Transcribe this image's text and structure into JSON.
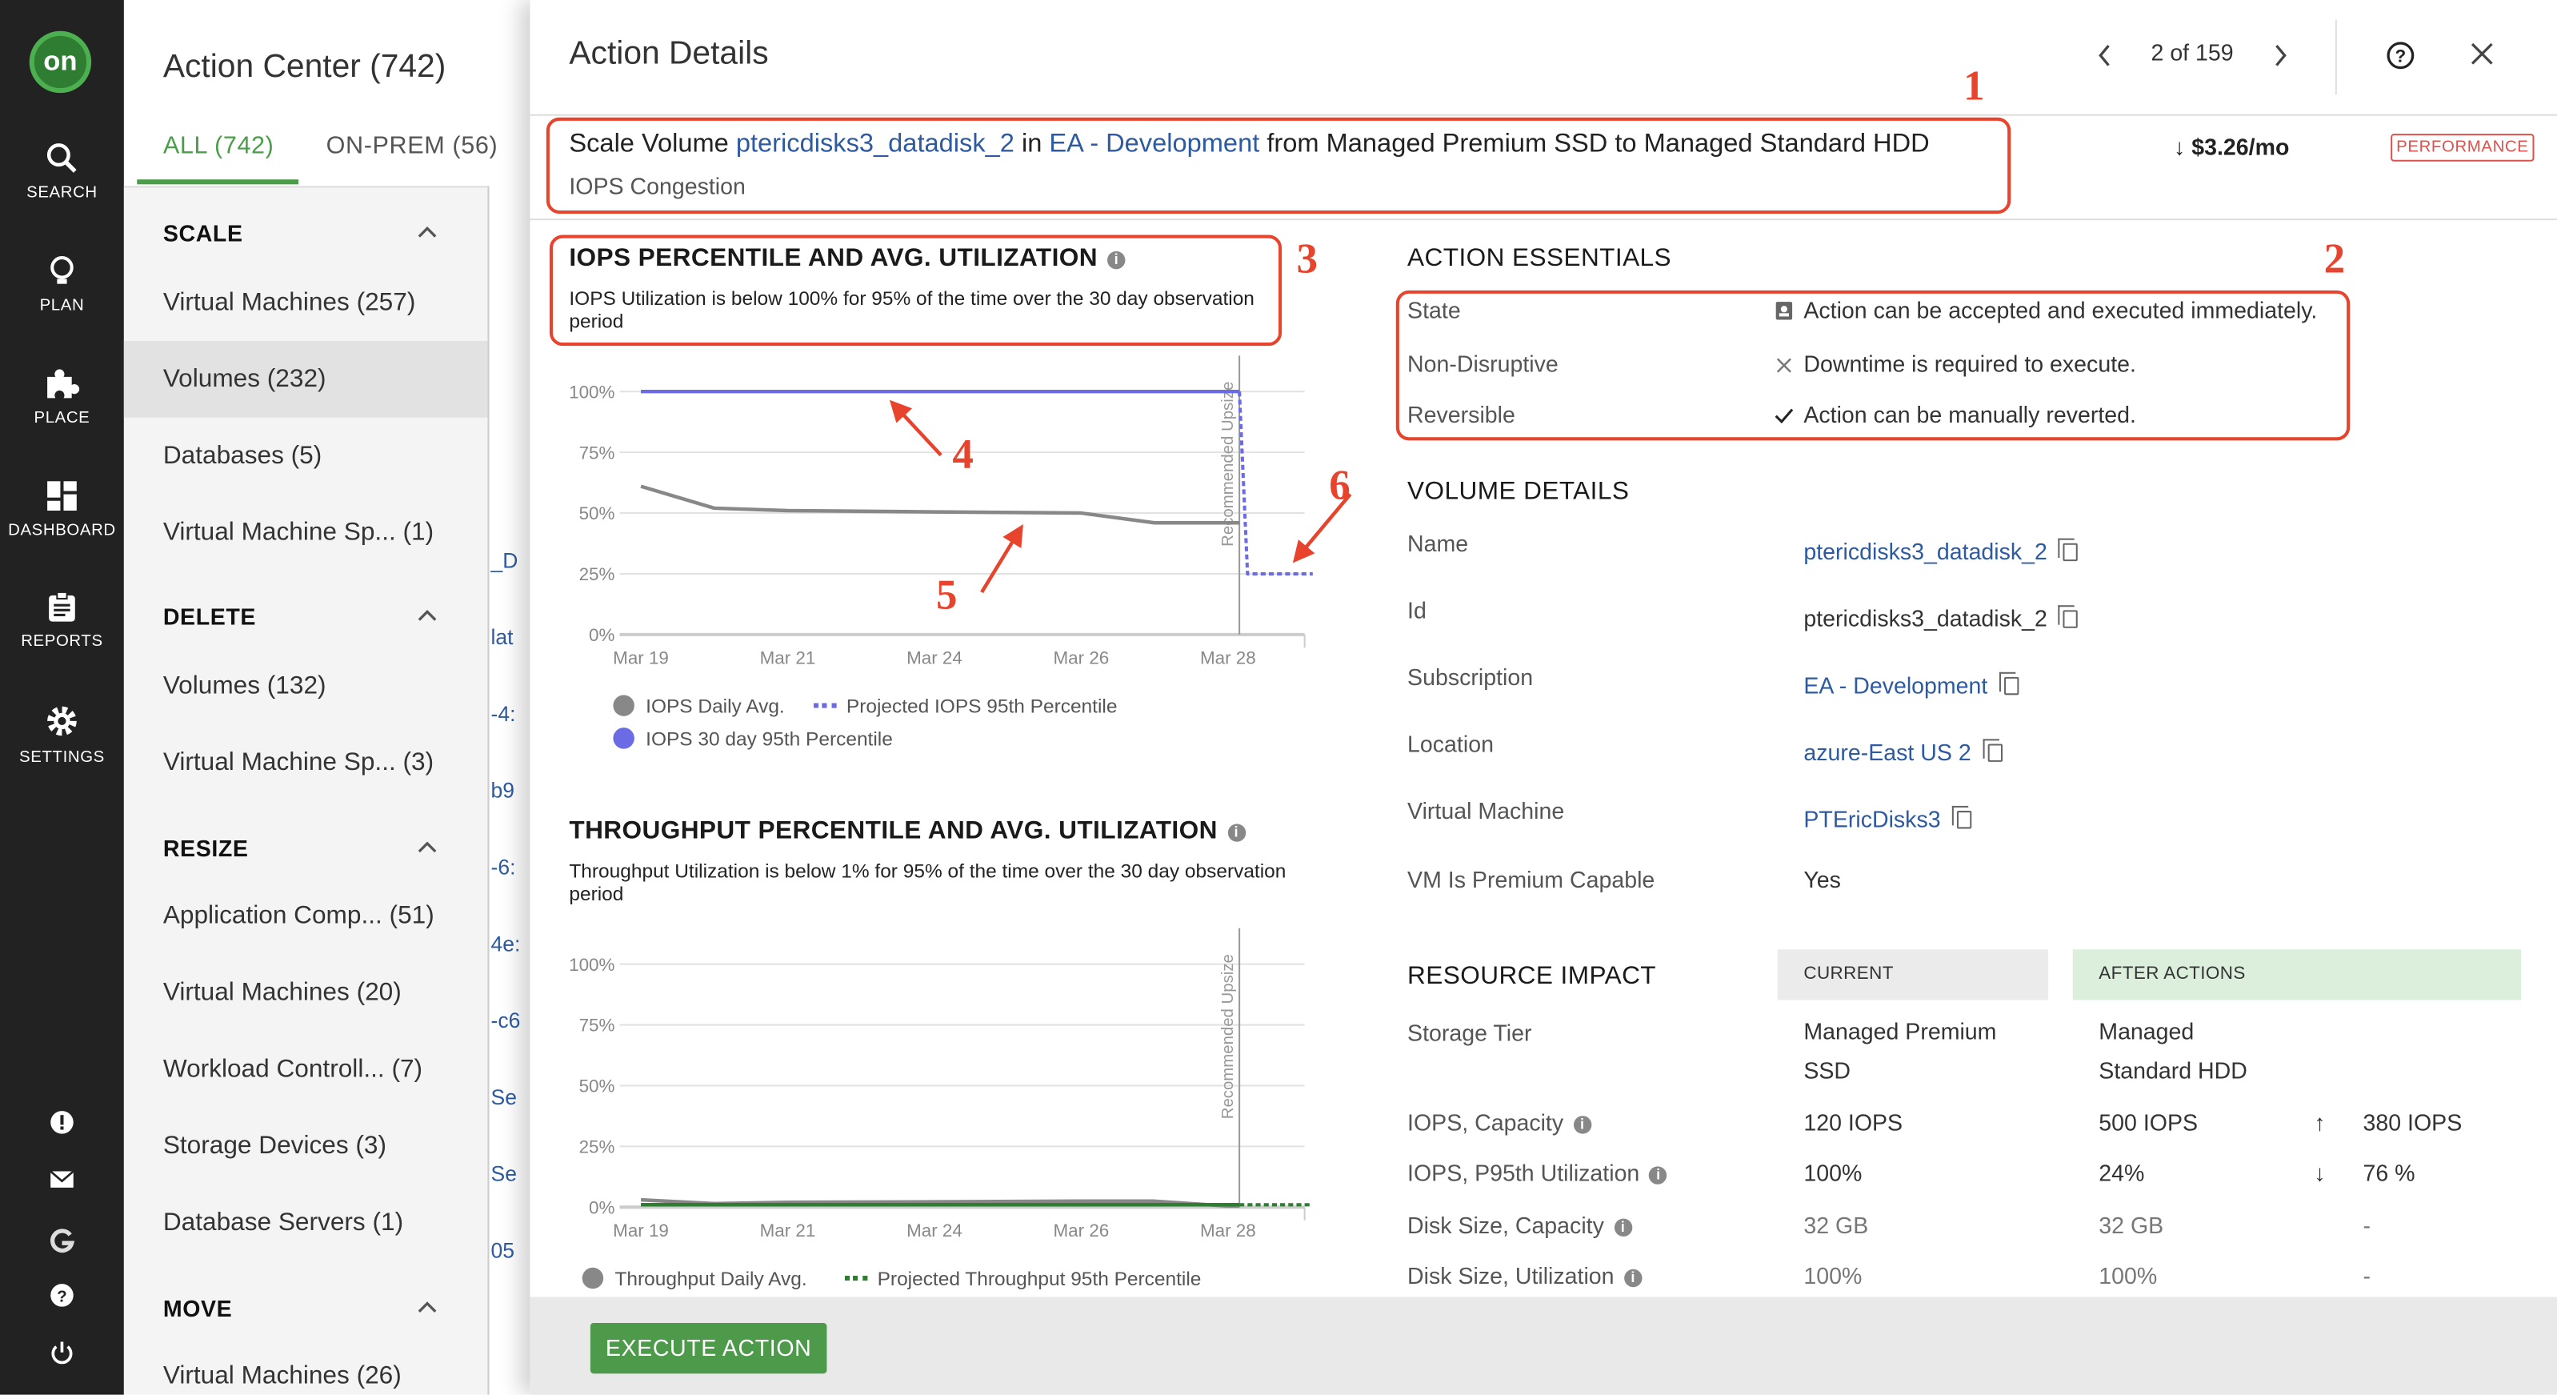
{
  "nav": {
    "logo": "on",
    "items": [
      {
        "label": "SEARCH",
        "icon": "search-icon"
      },
      {
        "label": "PLAN",
        "icon": "lightbulb-icon"
      },
      {
        "label": "PLACE",
        "icon": "puzzle-icon"
      },
      {
        "label": "DASHBOARD",
        "icon": "dashboard-icon"
      },
      {
        "label": "REPORTS",
        "icon": "clipboard-icon"
      },
      {
        "label": "SETTINGS",
        "icon": "gear-icon"
      }
    ],
    "bottom_icons": [
      "alert-icon",
      "mail-icon",
      "g-logo-icon",
      "help-icon",
      "power-icon"
    ]
  },
  "action_center": {
    "title": "Action Center (742)",
    "tabs": [
      {
        "label": "ALL (742)",
        "active": true
      },
      {
        "label": "ON-PREM (56)",
        "active": false
      }
    ],
    "sections": [
      {
        "title": "SCALE",
        "items": [
          "Virtual Machines (257)",
          "Volumes (232)",
          "Databases (5)",
          "Virtual Machine Sp...  (1)"
        ]
      },
      {
        "title": "DELETE",
        "items": [
          "Volumes (132)",
          "Virtual Machine Sp...  (3)"
        ]
      },
      {
        "title": "RESIZE",
        "items": [
          "Application Comp...  (51)",
          "Virtual Machines (20)",
          "Workload Controll...   (7)",
          "Storage Devices (3)",
          "Database Servers (1)"
        ]
      },
      {
        "title": "MOVE",
        "items": [
          "Virtual Machines (26)"
        ]
      }
    ],
    "selected_item": "Volumes (232)",
    "background_fragments": [
      "_D",
      "lat",
      "-4:",
      "b9",
      "-6:",
      "4e:",
      "-c6",
      "Se",
      "Se",
      "05"
    ]
  },
  "details": {
    "title": "Action Details",
    "pager": "2 of 159",
    "summary": {
      "prefix": "Scale Volume ",
      "volume_link": "ptericdisks3_datadisk_2",
      "in": " in ",
      "account_link": "EA - Development",
      "suffix": " from Managed Premium SSD to Managed Standard HDD",
      "reason": "IOPS Congestion",
      "savings": "$3.26/mo",
      "badge": "PERFORMANCE"
    },
    "iops_section": {
      "title": "IOPS PERCENTILE AND AVG. UTILIZATION",
      "description": "IOPS Utilization is below 100% for 95% of the time over the 30 day observation period",
      "legend": [
        "IOPS Daily Avg.",
        "Projected IOPS 95th Percentile",
        "IOPS 30 day 95th Percentile"
      ]
    },
    "throughput_section": {
      "title": "THROUGHPUT PERCENTILE AND AVG. UTILIZATION",
      "description": "Throughput Utilization is below 1% for 95% of the time over the 30 day observation period",
      "legend": [
        "Throughput Daily Avg.",
        "Projected Throughput 95th Percentile"
      ]
    },
    "essentials": {
      "title": "ACTION ESSENTIALS",
      "rows": [
        {
          "label": "State",
          "icon": "lock-icon",
          "value": "Action can be accepted and executed immediately."
        },
        {
          "label": "Non-Disruptive",
          "icon": "x-icon",
          "value": "Downtime is required to execute."
        },
        {
          "label": "Reversible",
          "icon": "check-icon",
          "value": "Action can be manually reverted."
        }
      ]
    },
    "volume_details": {
      "title": "VOLUME DETAILS",
      "rows": [
        {
          "label": "Name",
          "value": "ptericdisks3_datadisk_2",
          "link": true,
          "copy": true
        },
        {
          "label": "Id",
          "value": "ptericdisks3_datadisk_2",
          "link": false,
          "copy": true
        },
        {
          "label": "Subscription",
          "value": "EA - Development",
          "link": true,
          "copy": true
        },
        {
          "label": "Location",
          "value": "azure-East US 2",
          "link": true,
          "copy": true
        },
        {
          "label": "Virtual Machine",
          "value": "PTEricDisks3",
          "link": true,
          "copy": true
        },
        {
          "label": "VM Is Premium Capable",
          "value": "Yes",
          "link": false,
          "copy": false
        }
      ]
    },
    "resource_impact": {
      "title": "RESOURCE IMPACT",
      "current_header": "CURRENT",
      "after_header": "AFTER ACTIONS",
      "rows": [
        {
          "label": "Storage Tier",
          "info": false,
          "current": [
            "Managed Premium",
            "SSD"
          ],
          "after": [
            "Managed",
            "Standard HDD"
          ],
          "arrow": "",
          "delta": ""
        },
        {
          "label": "IOPS, Capacity",
          "info": true,
          "current": [
            "120 IOPS"
          ],
          "after": [
            "500 IOPS"
          ],
          "arrow": "↑",
          "delta": "380 IOPS"
        },
        {
          "label": "IOPS, P95th Utilization",
          "info": true,
          "current": [
            "100%"
          ],
          "after": [
            "24%"
          ],
          "arrow": "↓",
          "delta": "76 %"
        },
        {
          "label": "Disk Size, Capacity",
          "info": true,
          "current": [
            "32 GB"
          ],
          "after": [
            "32 GB"
          ],
          "arrow": "",
          "delta": "-"
        },
        {
          "label": "Disk Size, Utilization",
          "info": true,
          "current": [
            "100%"
          ],
          "after": [
            "100%"
          ],
          "arrow": "",
          "delta": "-"
        }
      ]
    },
    "execute_label": "EXECUTE ACTION"
  },
  "annotations": [
    "1",
    "2",
    "3",
    "4",
    "5",
    "6"
  ],
  "colors": {
    "accent_green": "#4a9e4a",
    "link": "#2d5aa0",
    "annotation_red": "#e8432c",
    "iops_percentile": "#6b6be6",
    "daily_avg": "#888888",
    "throughput_green": "#2e7d32"
  },
  "chart_data": [
    {
      "type": "line",
      "title": "IOPS PERCENTILE AND AVG. UTILIZATION",
      "x_ticks": [
        "Mar 19",
        "Mar 21",
        "Mar 24",
        "Mar 26",
        "Mar 28"
      ],
      "y_ticks": [
        "0%",
        "25%",
        "50%",
        "75%",
        "100%"
      ],
      "ylim": [
        0,
        100
      ],
      "grid": true,
      "marker_line": {
        "x": "Mar 28",
        "label": "Recommended Upsize"
      },
      "series": [
        {
          "name": "IOPS Daily Avg.",
          "color": "#888888",
          "style": "solid",
          "points": [
            [
              "Mar 19",
              61
            ],
            [
              "Mar 20",
              52
            ],
            [
              "Mar 21",
              51
            ],
            [
              "Mar 24",
              50.5
            ],
            [
              "Mar 26",
              50
            ],
            [
              "Mar 27",
              46
            ],
            [
              "Mar 28",
              46
            ]
          ]
        },
        {
          "name": "IOPS 30 day 95th Percentile",
          "color": "#6b6be6",
          "style": "solid",
          "points": [
            [
              "Mar 19",
              100
            ],
            [
              "Mar 28",
              100
            ]
          ]
        },
        {
          "name": "Projected IOPS 95th Percentile",
          "color": "#6b6be6",
          "style": "dotted",
          "points": [
            [
              "Mar 28",
              100
            ],
            [
              "Mar 28",
              25
            ],
            [
              "Mar 29",
              25
            ]
          ]
        }
      ]
    },
    {
      "type": "line",
      "title": "THROUGHPUT PERCENTILE AND AVG. UTILIZATION",
      "x_ticks": [
        "Mar 19",
        "Mar 21",
        "Mar 24",
        "Mar 26",
        "Mar 28"
      ],
      "y_ticks": [
        "0%",
        "25%",
        "50%",
        "75%",
        "100%"
      ],
      "ylim": [
        0,
        100
      ],
      "grid": true,
      "marker_line": {
        "x": "Mar 28",
        "label": "Recommended Upsize"
      },
      "series": [
        {
          "name": "Throughput Daily Avg.",
          "color": "#888888",
          "style": "solid",
          "points": [
            [
              "Mar 19",
              3
            ],
            [
              "Mar 20",
              1.5
            ],
            [
              "Mar 21",
              2
            ],
            [
              "Mar 24",
              2.2
            ],
            [
              "Mar 26",
              2.5
            ],
            [
              "Mar 27",
              2.5
            ],
            [
              "Mar 28",
              0.5
            ]
          ]
        },
        {
          "name": "",
          "color": "#2e7d32",
          "style": "solid",
          "points": [
            [
              "Mar 19",
              1
            ],
            [
              "Mar 28",
              1
            ]
          ]
        },
        {
          "name": "Projected Throughput 95th Percentile",
          "color": "#2e7d32",
          "style": "dotted",
          "points": [
            [
              "Mar 28",
              1
            ],
            [
              "Mar 29",
              1
            ]
          ]
        }
      ]
    }
  ]
}
